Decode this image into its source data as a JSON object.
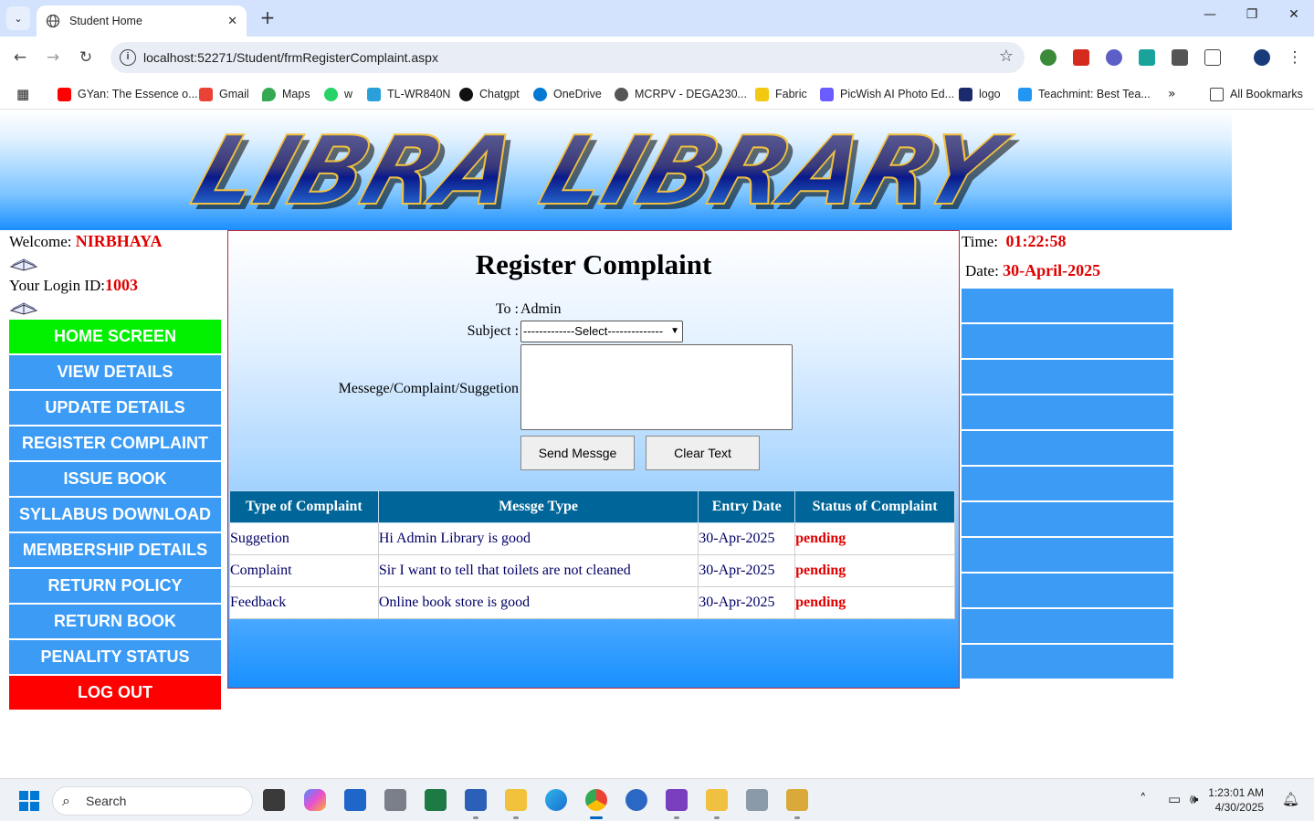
{
  "browser": {
    "tab_title": "Student Home",
    "url": "localhost:52271/Student/frmRegisterComplaint.aspx",
    "bookmarks": [
      {
        "label": "GYan: The Essence o...",
        "color": "#ff0000"
      },
      {
        "label": "Gmail",
        "color": "#ea4335"
      },
      {
        "label": "Maps",
        "color": "#34a853"
      },
      {
        "label": "w",
        "color": "#25d366"
      },
      {
        "label": "TL-WR840N",
        "color": "#2b9fd9"
      },
      {
        "label": "Chatgpt",
        "color": "#111111"
      },
      {
        "label": "OneDrive",
        "color": "#0078d4"
      },
      {
        "label": "MCRPV - DEGA230...",
        "color": "#555555"
      },
      {
        "label": "Fabric",
        "color": "#f2c811"
      },
      {
        "label": "PicWish AI Photo Ed...",
        "color": "#6a5cff"
      },
      {
        "label": "logo",
        "color": "#1a2a6c"
      },
      {
        "label": "Teachmint: Best Tea...",
        "color": "#2196f3"
      }
    ],
    "all_bookmarks": "All Bookmarks"
  },
  "sidebar": {
    "welcome_label": "Welcome:",
    "user_name": "NIRBHAYA",
    "login_label": "Your Login ID:",
    "login_id": "1003",
    "menu": [
      {
        "label": "HOME SCREEN",
        "kind": "home"
      },
      {
        "label": "VIEW DETAILS",
        "kind": "normal"
      },
      {
        "label": "UPDATE DETAILS",
        "kind": "normal"
      },
      {
        "label": "REGISTER COMPLAINT",
        "kind": "normal"
      },
      {
        "label": "ISSUE BOOK",
        "kind": "normal"
      },
      {
        "label": "SYLLABUS DOWNLOAD",
        "kind": "normal"
      },
      {
        "label": "MEMBERSHIP DETAILS",
        "kind": "normal"
      },
      {
        "label": "RETURN POLICY",
        "kind": "normal"
      },
      {
        "label": "RETURN BOOK",
        "kind": "normal"
      },
      {
        "label": "PENALITY STATUS",
        "kind": "normal"
      },
      {
        "label": "LOG OUT",
        "kind": "logout"
      }
    ]
  },
  "banner": {
    "logo_text": "LIBRA LIBRARY"
  },
  "form": {
    "title": "Register Complaint",
    "to_label": "To :",
    "to_value": "Admin",
    "subject_label": "Subject :",
    "subject_selected": "-------------Select--------------",
    "message_label": "Messege/Complaint/Suggetion",
    "message_value": "",
    "send_button": "Send Messge",
    "clear_button": "Clear Text"
  },
  "grid": {
    "headers": [
      "Type of Complaint",
      "Messge Type",
      "Entry Date",
      "Status of Complaint"
    ],
    "rows": [
      [
        "Suggetion",
        "Hi Admin Library is good",
        "30-Apr-2025",
        "pending"
      ],
      [
        "Complaint",
        "Sir I want to tell that toilets are not cleaned",
        "30-Apr-2025",
        "pending"
      ],
      [
        "Feedback",
        "Online book store is good",
        "30-Apr-2025",
        "pending"
      ]
    ]
  },
  "right": {
    "time_label": "Time:",
    "time_value": "01:22:58",
    "date_label": "Date:",
    "date_value": "30-April-2025"
  },
  "taskbar": {
    "search_placeholder": "Search",
    "clock_time": "1:23:01 AM",
    "clock_date": "4/30/2025"
  }
}
